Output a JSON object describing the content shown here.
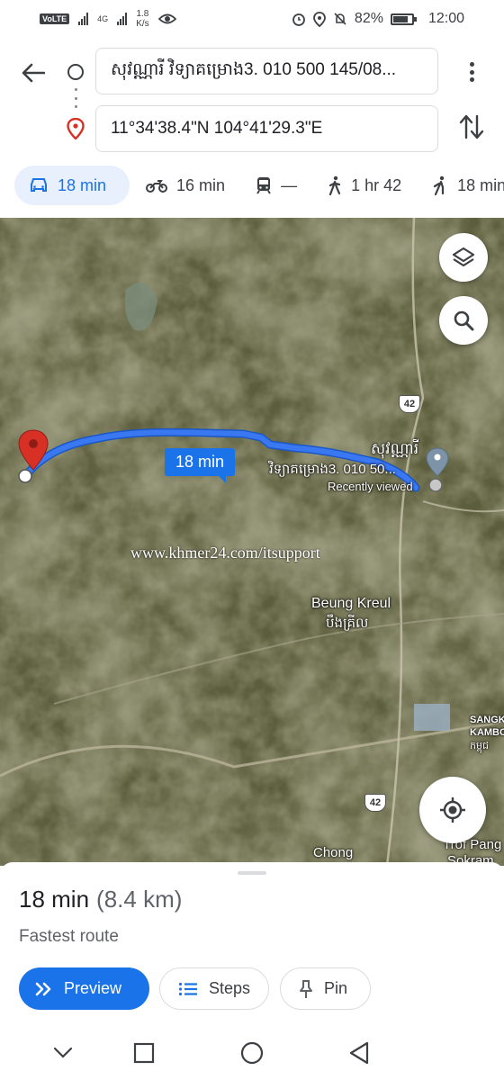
{
  "status_bar": {
    "volte": "VoLTE",
    "network": "4G",
    "speed_value": "1.8",
    "speed_unit": "K/s",
    "battery_percent": "82%",
    "battery_level": 0.82,
    "time": "12:00"
  },
  "directions": {
    "origin_text": "សុវណ្ណារី វិទ្យាគម្រោង3. 010 500 145/08...",
    "destination_text": "11°34'38.4\"N 104°41'29.3\"E"
  },
  "modes": [
    {
      "icon": "car-icon",
      "label": "18 min",
      "active": true
    },
    {
      "icon": "motorcycle-icon",
      "label": "16 min",
      "active": false
    },
    {
      "icon": "transit-icon",
      "label": "—",
      "active": false
    },
    {
      "icon": "walking-icon",
      "label": "1 hr 42",
      "active": false
    },
    {
      "icon": "ride-icon",
      "label": "18 min",
      "active": false
    }
  ],
  "map": {
    "route_label": "18 min",
    "route_color": "#3a78f2",
    "place_name_line1": "សុវណ្ណារី",
    "place_name_line2": "វិទ្យាគម្រោង3. 010 50...",
    "place_note": "Recently viewed",
    "watermark": "www.khmer24.com/itsupport",
    "area_name": "Beung Kreul",
    "area_name_khmer": "បឹងគ្រីល",
    "road_badge": "42",
    "right_label_1": "SANGK",
    "right_label_2": "KAMBO",
    "right_label_3": "កម្ពុជ",
    "bottom_label_1": "Chong",
    "bottom_label_2": "Trof Pang",
    "bottom_label_3": "Sokram"
  },
  "sheet": {
    "duration": "18 min",
    "distance": "(8.4 km)",
    "subtitle": "Fastest route",
    "preview_label": "Preview",
    "steps_label": "Steps",
    "pin_label": "Pin"
  },
  "colors": {
    "accent": "#1a73e8",
    "pin_red": "#d93025",
    "chip_bg": "#e8f0fe"
  }
}
